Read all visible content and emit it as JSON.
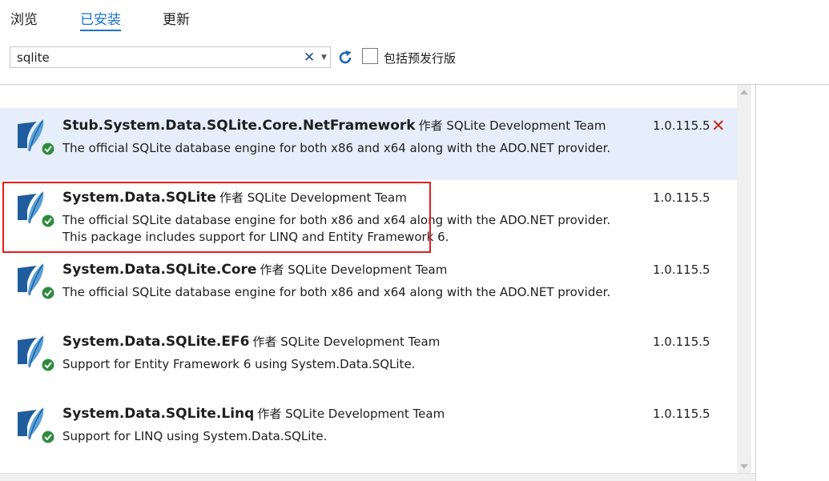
{
  "tabs": [
    {
      "label": "浏览"
    },
    {
      "label": "已安装"
    },
    {
      "label": "更新"
    }
  ],
  "search": {
    "value": "sqlite"
  },
  "prerelease": {
    "label": "包括预发行版",
    "checked": false
  },
  "packages": [
    {
      "name": "Stub.System.Data.SQLite.Core.NetFramework",
      "author": "作者 SQLite Development Team",
      "description": "The official SQLite database engine for both x86 and x64 along with the ADO.NET provider.",
      "version": "1.0.115.5",
      "selected": true,
      "installed": true
    },
    {
      "name": "System.Data.SQLite",
      "author": "作者 SQLite Development Team",
      "description": "The official SQLite database engine for both x86 and x64 along with the ADO.NET provider.  This package includes support for LINQ and Entity Framework 6.",
      "version": "1.0.115.5",
      "installed": true
    },
    {
      "name": "System.Data.SQLite.Core",
      "author": "作者 SQLite Development Team",
      "description": "The official SQLite database engine for both x86 and x64 along with the ADO.NET provider.",
      "version": "1.0.115.5",
      "installed": true
    },
    {
      "name": "System.Data.SQLite.EF6",
      "author": "作者 SQLite Development Team",
      "description": "Support for Entity Framework 6 using System.Data.SQLite.",
      "version": "1.0.115.5",
      "installed": true
    },
    {
      "name": "System.Data.SQLite.Linq",
      "author": "作者 SQLite Development Team",
      "description": "Support for LINQ using System.Data.SQLite.",
      "version": "1.0.115.5",
      "installed": true
    }
  ],
  "icons": {
    "package": "sqlite-feather-icon",
    "installed": "check-circle-icon",
    "uninstall": "close-icon",
    "clear": "close-icon",
    "refresh": "refresh-icon",
    "dropdown": "chevron-down-icon"
  },
  "colors": {
    "accent": "#1a73c7",
    "selected_row": "#e5eefa",
    "highlight_border": "#e51c1c",
    "installed_check": "#2e8b3e",
    "uninstall": "#c42b1c"
  }
}
